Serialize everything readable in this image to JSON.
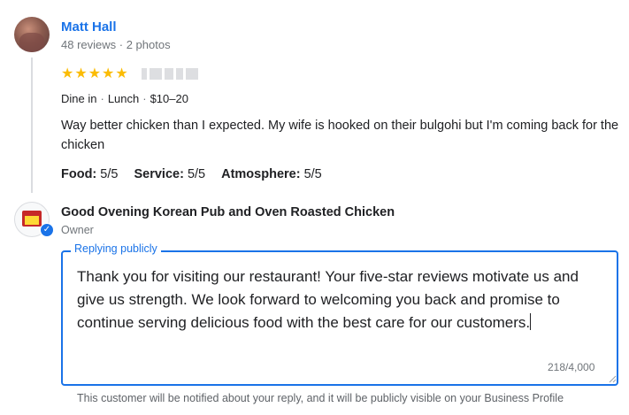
{
  "reviewer": {
    "name": "Matt Hall",
    "meta": "48 reviews · 2 photos",
    "stars": "★★★★★"
  },
  "visit": {
    "type": "Dine in",
    "meal": "Lunch",
    "price": "$10–20"
  },
  "review_text": "Way better chicken than I expected. My wife is hooked on their bulgohi but I'm coming back for the chicken",
  "ratings": [
    {
      "label": "Food:",
      "value": "5/5"
    },
    {
      "label": "Service:",
      "value": "5/5"
    },
    {
      "label": "Atmosphere:",
      "value": "5/5"
    }
  ],
  "owner": {
    "name": "Good Ovening Korean Pub and Oven Roasted Chicken",
    "role": "Owner"
  },
  "reply": {
    "legend": "Replying publicly",
    "text": "Thank you for visiting our restaurant! Your five-star reviews motivate us and give us strength. We look forward to welcoming you back and promise to continue serving delicious food with the best care for our customers.",
    "counter": "218/4,000"
  },
  "notice": "This customer will be notified about your reply, and it will be publicly visible on your Business Profile",
  "colors": {
    "accent": "#1a73e8",
    "star": "#fbbc04"
  }
}
